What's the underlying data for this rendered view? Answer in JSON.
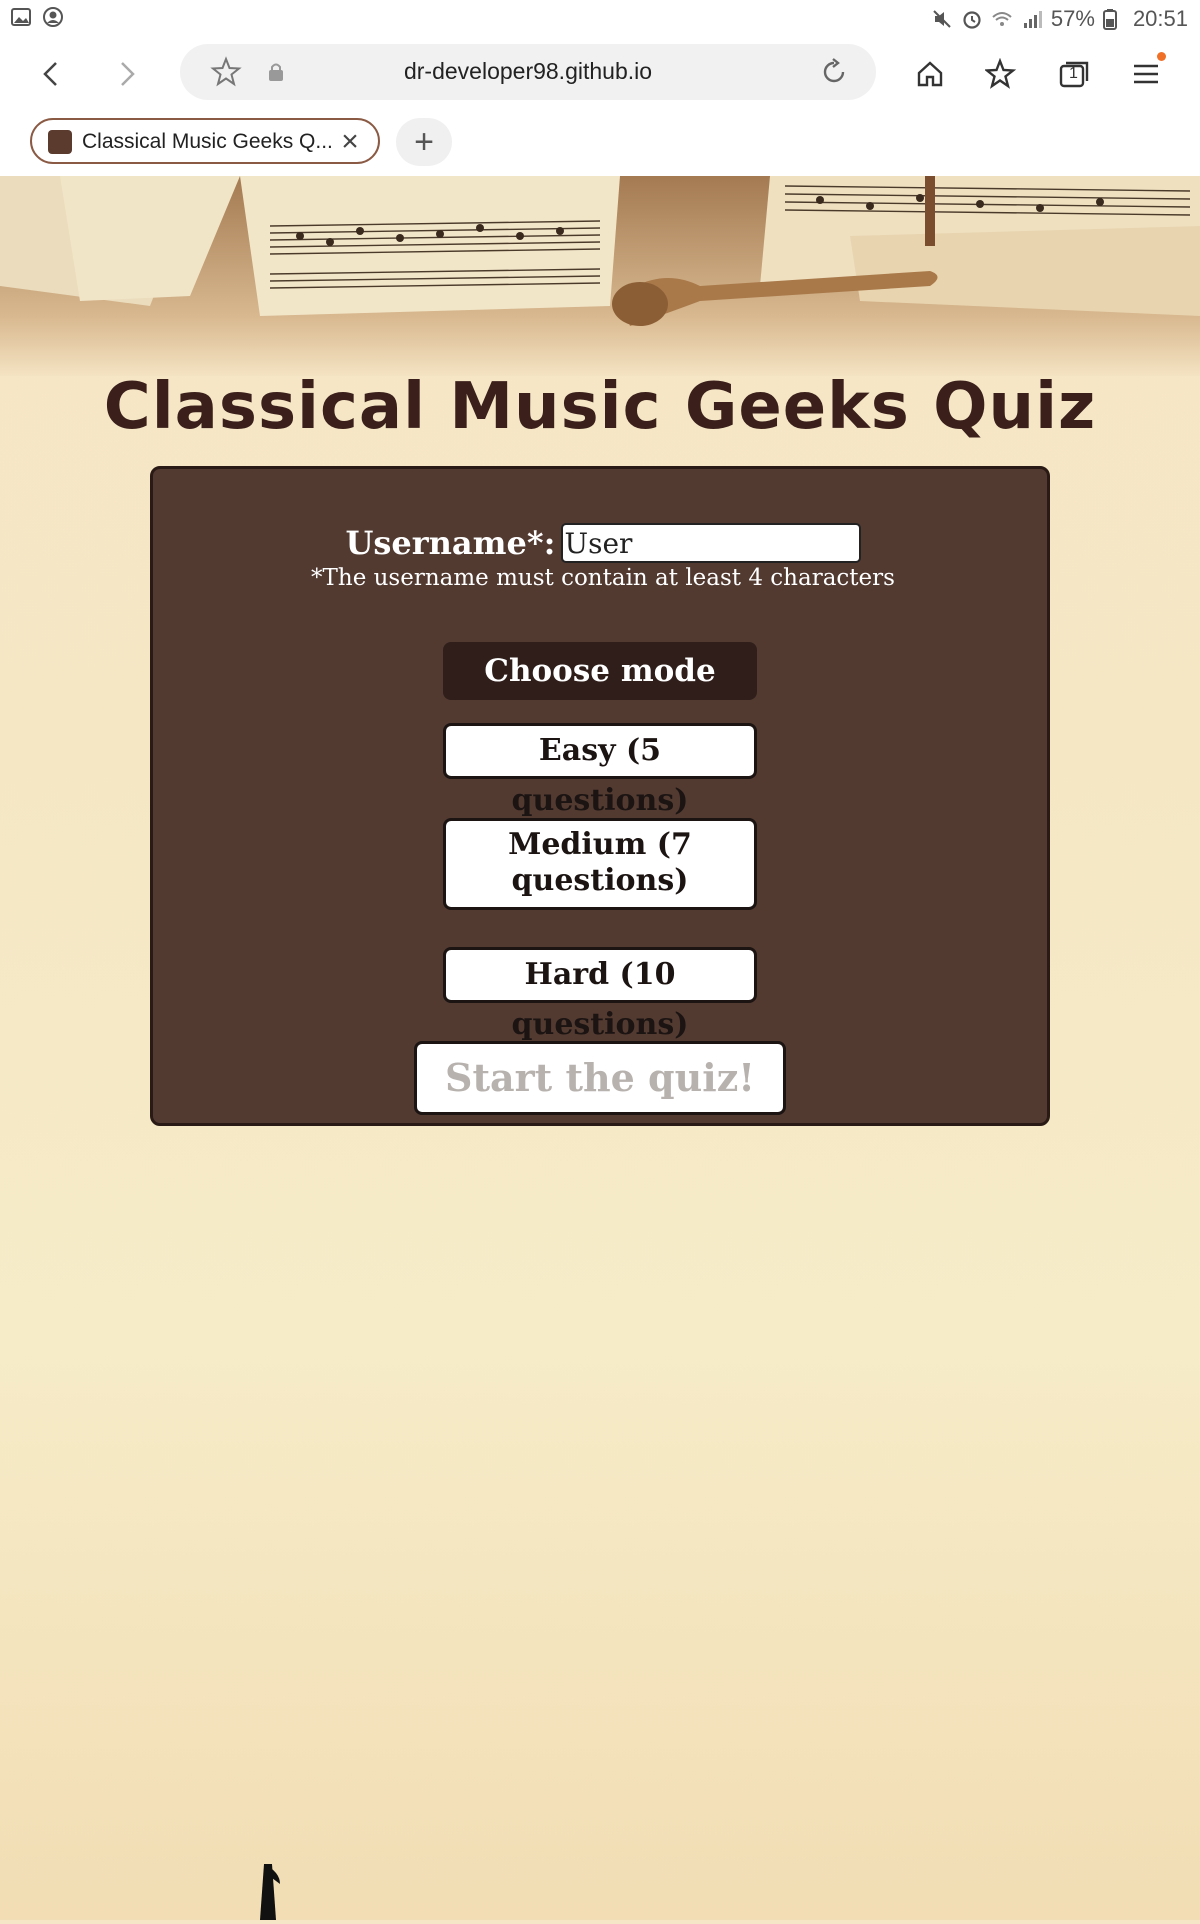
{
  "status_bar": {
    "battery": "57%",
    "time": "20:51"
  },
  "browser": {
    "url": "dr-developer98.github.io",
    "tab_title": "Classical Music Geeks Q...",
    "new_tab_label": "+",
    "tab_count": "1"
  },
  "page": {
    "title": "Classical Music Geeks Quiz",
    "username_label": "Username*:",
    "username_value": "User",
    "username_hint": "*The username must contain at least 4 characters",
    "choose_mode": "Choose mode",
    "modes": [
      {
        "label": "Easy (5 questions)"
      },
      {
        "label": "Medium (7 questions)"
      },
      {
        "label": "Hard (10 questions)"
      }
    ],
    "start_label": "Start the quiz!"
  }
}
